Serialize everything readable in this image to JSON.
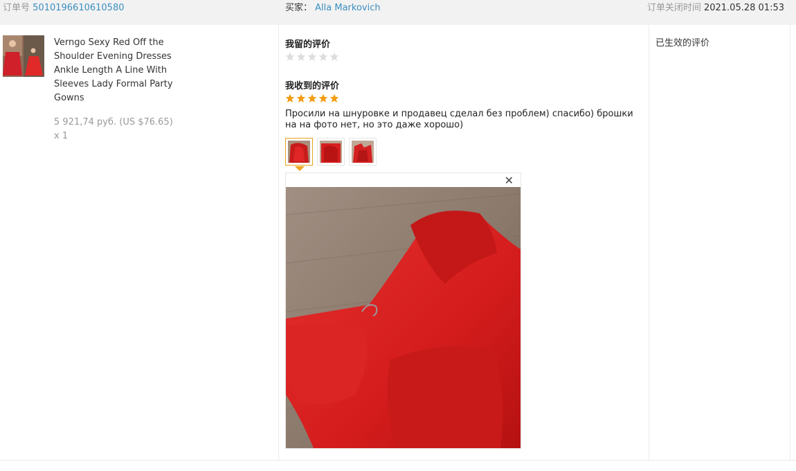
{
  "header": {
    "order_label": "订单号",
    "order_number": "5010196610610580",
    "buyer_label": "买家：",
    "buyer_name": "Alla Markovich",
    "closed_label": "订单关闭时间",
    "closed_time": "2021.05.28 01:53"
  },
  "product": {
    "title": "Verngo Sexy Red Off the Shoulder Evening Dresses Ankle Length A Line With Sleeves Lady Formal Party Gowns",
    "price": "5 921,74 руб. (US $76.65)",
    "quantity": "x 1",
    "thumbnail_icon": "red-dress-thumbnail"
  },
  "feedback": {
    "left_title": "我留的评价",
    "left_rating": 0,
    "received_title": "我收到的评价",
    "received_rating": 5,
    "comment": "Просили на шнуровке и продавец сделал без проблем) спасибо) брошки на на фото нет, но это даже хорошо)",
    "photo_count": 3,
    "selected_photo": 1,
    "close_icon": "close-icon"
  },
  "status": {
    "effective_label": "已生效的评价"
  },
  "colors": {
    "link": "#3a8fc1",
    "star_active": "#f39c12",
    "star_inactive": "#dddddd",
    "dress_red": "#d81e1e"
  }
}
